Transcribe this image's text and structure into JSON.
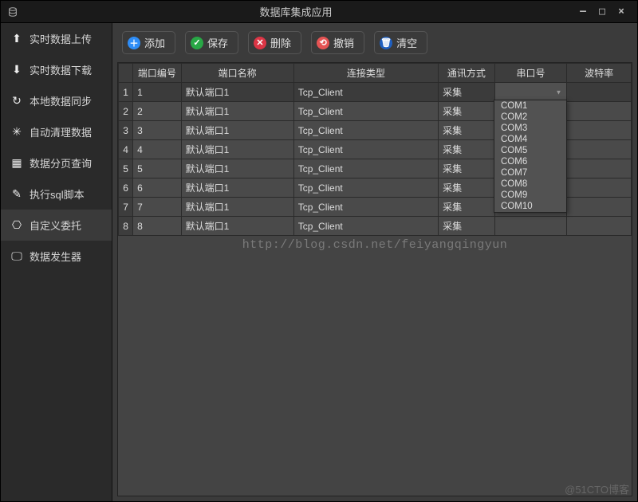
{
  "title": "数据库集成应用",
  "sidebar": {
    "items": [
      {
        "label": "实时数据上传"
      },
      {
        "label": "实时数据下载"
      },
      {
        "label": "本地数据同步"
      },
      {
        "label": "自动清理数据"
      },
      {
        "label": "数据分页查询"
      },
      {
        "label": "执行sql脚本"
      },
      {
        "label": "自定义委托"
      },
      {
        "label": "数据发生器"
      }
    ],
    "active_index": 6
  },
  "toolbar": {
    "add_label": "添加",
    "save_label": "保存",
    "delete_label": "删除",
    "undo_label": "撤销",
    "clear_label": "清空"
  },
  "table": {
    "columns": [
      "端口编号",
      "端口名称",
      "连接类型",
      "通讯方式",
      "串口号",
      "波特率"
    ],
    "rows": [
      {
        "no": "1",
        "name": "默认端口1",
        "conn": "Tcp_Client",
        "mode": "采集",
        "com": "",
        "baud": ""
      },
      {
        "no": "2",
        "name": "默认端口1",
        "conn": "Tcp_Client",
        "mode": "采集",
        "com": "",
        "baud": ""
      },
      {
        "no": "3",
        "name": "默认端口1",
        "conn": "Tcp_Client",
        "mode": "采集",
        "com": "",
        "baud": ""
      },
      {
        "no": "4",
        "name": "默认端口1",
        "conn": "Tcp_Client",
        "mode": "采集",
        "com": "",
        "baud": ""
      },
      {
        "no": "5",
        "name": "默认端口1",
        "conn": "Tcp_Client",
        "mode": "采集",
        "com": "",
        "baud": ""
      },
      {
        "no": "6",
        "name": "默认端口1",
        "conn": "Tcp_Client",
        "mode": "采集",
        "com": "",
        "baud": ""
      },
      {
        "no": "7",
        "name": "默认端口1",
        "conn": "Tcp_Client",
        "mode": "采集",
        "com": "",
        "baud": ""
      },
      {
        "no": "8",
        "name": "默认端口1",
        "conn": "Tcp_Client",
        "mode": "采集",
        "com": "",
        "baud": ""
      }
    ],
    "selected_row": 0,
    "com_cell": {
      "row": 0,
      "value": ""
    },
    "dropdown_options": [
      "COM1",
      "COM2",
      "COM3",
      "COM4",
      "COM5",
      "COM6",
      "COM7",
      "COM8",
      "COM9",
      "COM10"
    ]
  },
  "watermark_center": "http://blog.csdn.net/feiyangqingyun",
  "watermark_br": "@51CTO博客"
}
